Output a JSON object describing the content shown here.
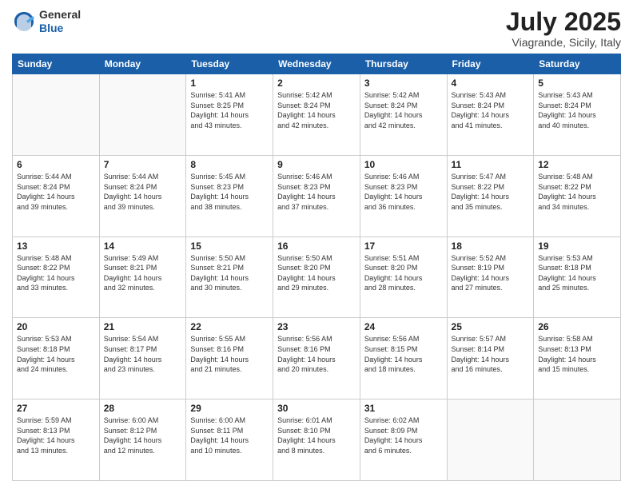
{
  "logo": {
    "general": "General",
    "blue": "Blue"
  },
  "header": {
    "month": "July 2025",
    "location": "Viagrande, Sicily, Italy"
  },
  "weekdays": [
    "Sunday",
    "Monday",
    "Tuesday",
    "Wednesday",
    "Thursday",
    "Friday",
    "Saturday"
  ],
  "weeks": [
    [
      {
        "day": "",
        "info": ""
      },
      {
        "day": "",
        "info": ""
      },
      {
        "day": "1",
        "info": "Sunrise: 5:41 AM\nSunset: 8:25 PM\nDaylight: 14 hours\nand 43 minutes."
      },
      {
        "day": "2",
        "info": "Sunrise: 5:42 AM\nSunset: 8:24 PM\nDaylight: 14 hours\nand 42 minutes."
      },
      {
        "day": "3",
        "info": "Sunrise: 5:42 AM\nSunset: 8:24 PM\nDaylight: 14 hours\nand 42 minutes."
      },
      {
        "day": "4",
        "info": "Sunrise: 5:43 AM\nSunset: 8:24 PM\nDaylight: 14 hours\nand 41 minutes."
      },
      {
        "day": "5",
        "info": "Sunrise: 5:43 AM\nSunset: 8:24 PM\nDaylight: 14 hours\nand 40 minutes."
      }
    ],
    [
      {
        "day": "6",
        "info": "Sunrise: 5:44 AM\nSunset: 8:24 PM\nDaylight: 14 hours\nand 39 minutes."
      },
      {
        "day": "7",
        "info": "Sunrise: 5:44 AM\nSunset: 8:24 PM\nDaylight: 14 hours\nand 39 minutes."
      },
      {
        "day": "8",
        "info": "Sunrise: 5:45 AM\nSunset: 8:23 PM\nDaylight: 14 hours\nand 38 minutes."
      },
      {
        "day": "9",
        "info": "Sunrise: 5:46 AM\nSunset: 8:23 PM\nDaylight: 14 hours\nand 37 minutes."
      },
      {
        "day": "10",
        "info": "Sunrise: 5:46 AM\nSunset: 8:23 PM\nDaylight: 14 hours\nand 36 minutes."
      },
      {
        "day": "11",
        "info": "Sunrise: 5:47 AM\nSunset: 8:22 PM\nDaylight: 14 hours\nand 35 minutes."
      },
      {
        "day": "12",
        "info": "Sunrise: 5:48 AM\nSunset: 8:22 PM\nDaylight: 14 hours\nand 34 minutes."
      }
    ],
    [
      {
        "day": "13",
        "info": "Sunrise: 5:48 AM\nSunset: 8:22 PM\nDaylight: 14 hours\nand 33 minutes."
      },
      {
        "day": "14",
        "info": "Sunrise: 5:49 AM\nSunset: 8:21 PM\nDaylight: 14 hours\nand 32 minutes."
      },
      {
        "day": "15",
        "info": "Sunrise: 5:50 AM\nSunset: 8:21 PM\nDaylight: 14 hours\nand 30 minutes."
      },
      {
        "day": "16",
        "info": "Sunrise: 5:50 AM\nSunset: 8:20 PM\nDaylight: 14 hours\nand 29 minutes."
      },
      {
        "day": "17",
        "info": "Sunrise: 5:51 AM\nSunset: 8:20 PM\nDaylight: 14 hours\nand 28 minutes."
      },
      {
        "day": "18",
        "info": "Sunrise: 5:52 AM\nSunset: 8:19 PM\nDaylight: 14 hours\nand 27 minutes."
      },
      {
        "day": "19",
        "info": "Sunrise: 5:53 AM\nSunset: 8:18 PM\nDaylight: 14 hours\nand 25 minutes."
      }
    ],
    [
      {
        "day": "20",
        "info": "Sunrise: 5:53 AM\nSunset: 8:18 PM\nDaylight: 14 hours\nand 24 minutes."
      },
      {
        "day": "21",
        "info": "Sunrise: 5:54 AM\nSunset: 8:17 PM\nDaylight: 14 hours\nand 23 minutes."
      },
      {
        "day": "22",
        "info": "Sunrise: 5:55 AM\nSunset: 8:16 PM\nDaylight: 14 hours\nand 21 minutes."
      },
      {
        "day": "23",
        "info": "Sunrise: 5:56 AM\nSunset: 8:16 PM\nDaylight: 14 hours\nand 20 minutes."
      },
      {
        "day": "24",
        "info": "Sunrise: 5:56 AM\nSunset: 8:15 PM\nDaylight: 14 hours\nand 18 minutes."
      },
      {
        "day": "25",
        "info": "Sunrise: 5:57 AM\nSunset: 8:14 PM\nDaylight: 14 hours\nand 16 minutes."
      },
      {
        "day": "26",
        "info": "Sunrise: 5:58 AM\nSunset: 8:13 PM\nDaylight: 14 hours\nand 15 minutes."
      }
    ],
    [
      {
        "day": "27",
        "info": "Sunrise: 5:59 AM\nSunset: 8:13 PM\nDaylight: 14 hours\nand 13 minutes."
      },
      {
        "day": "28",
        "info": "Sunrise: 6:00 AM\nSunset: 8:12 PM\nDaylight: 14 hours\nand 12 minutes."
      },
      {
        "day": "29",
        "info": "Sunrise: 6:00 AM\nSunset: 8:11 PM\nDaylight: 14 hours\nand 10 minutes."
      },
      {
        "day": "30",
        "info": "Sunrise: 6:01 AM\nSunset: 8:10 PM\nDaylight: 14 hours\nand 8 minutes."
      },
      {
        "day": "31",
        "info": "Sunrise: 6:02 AM\nSunset: 8:09 PM\nDaylight: 14 hours\nand 6 minutes."
      },
      {
        "day": "",
        "info": ""
      },
      {
        "day": "",
        "info": ""
      }
    ]
  ]
}
